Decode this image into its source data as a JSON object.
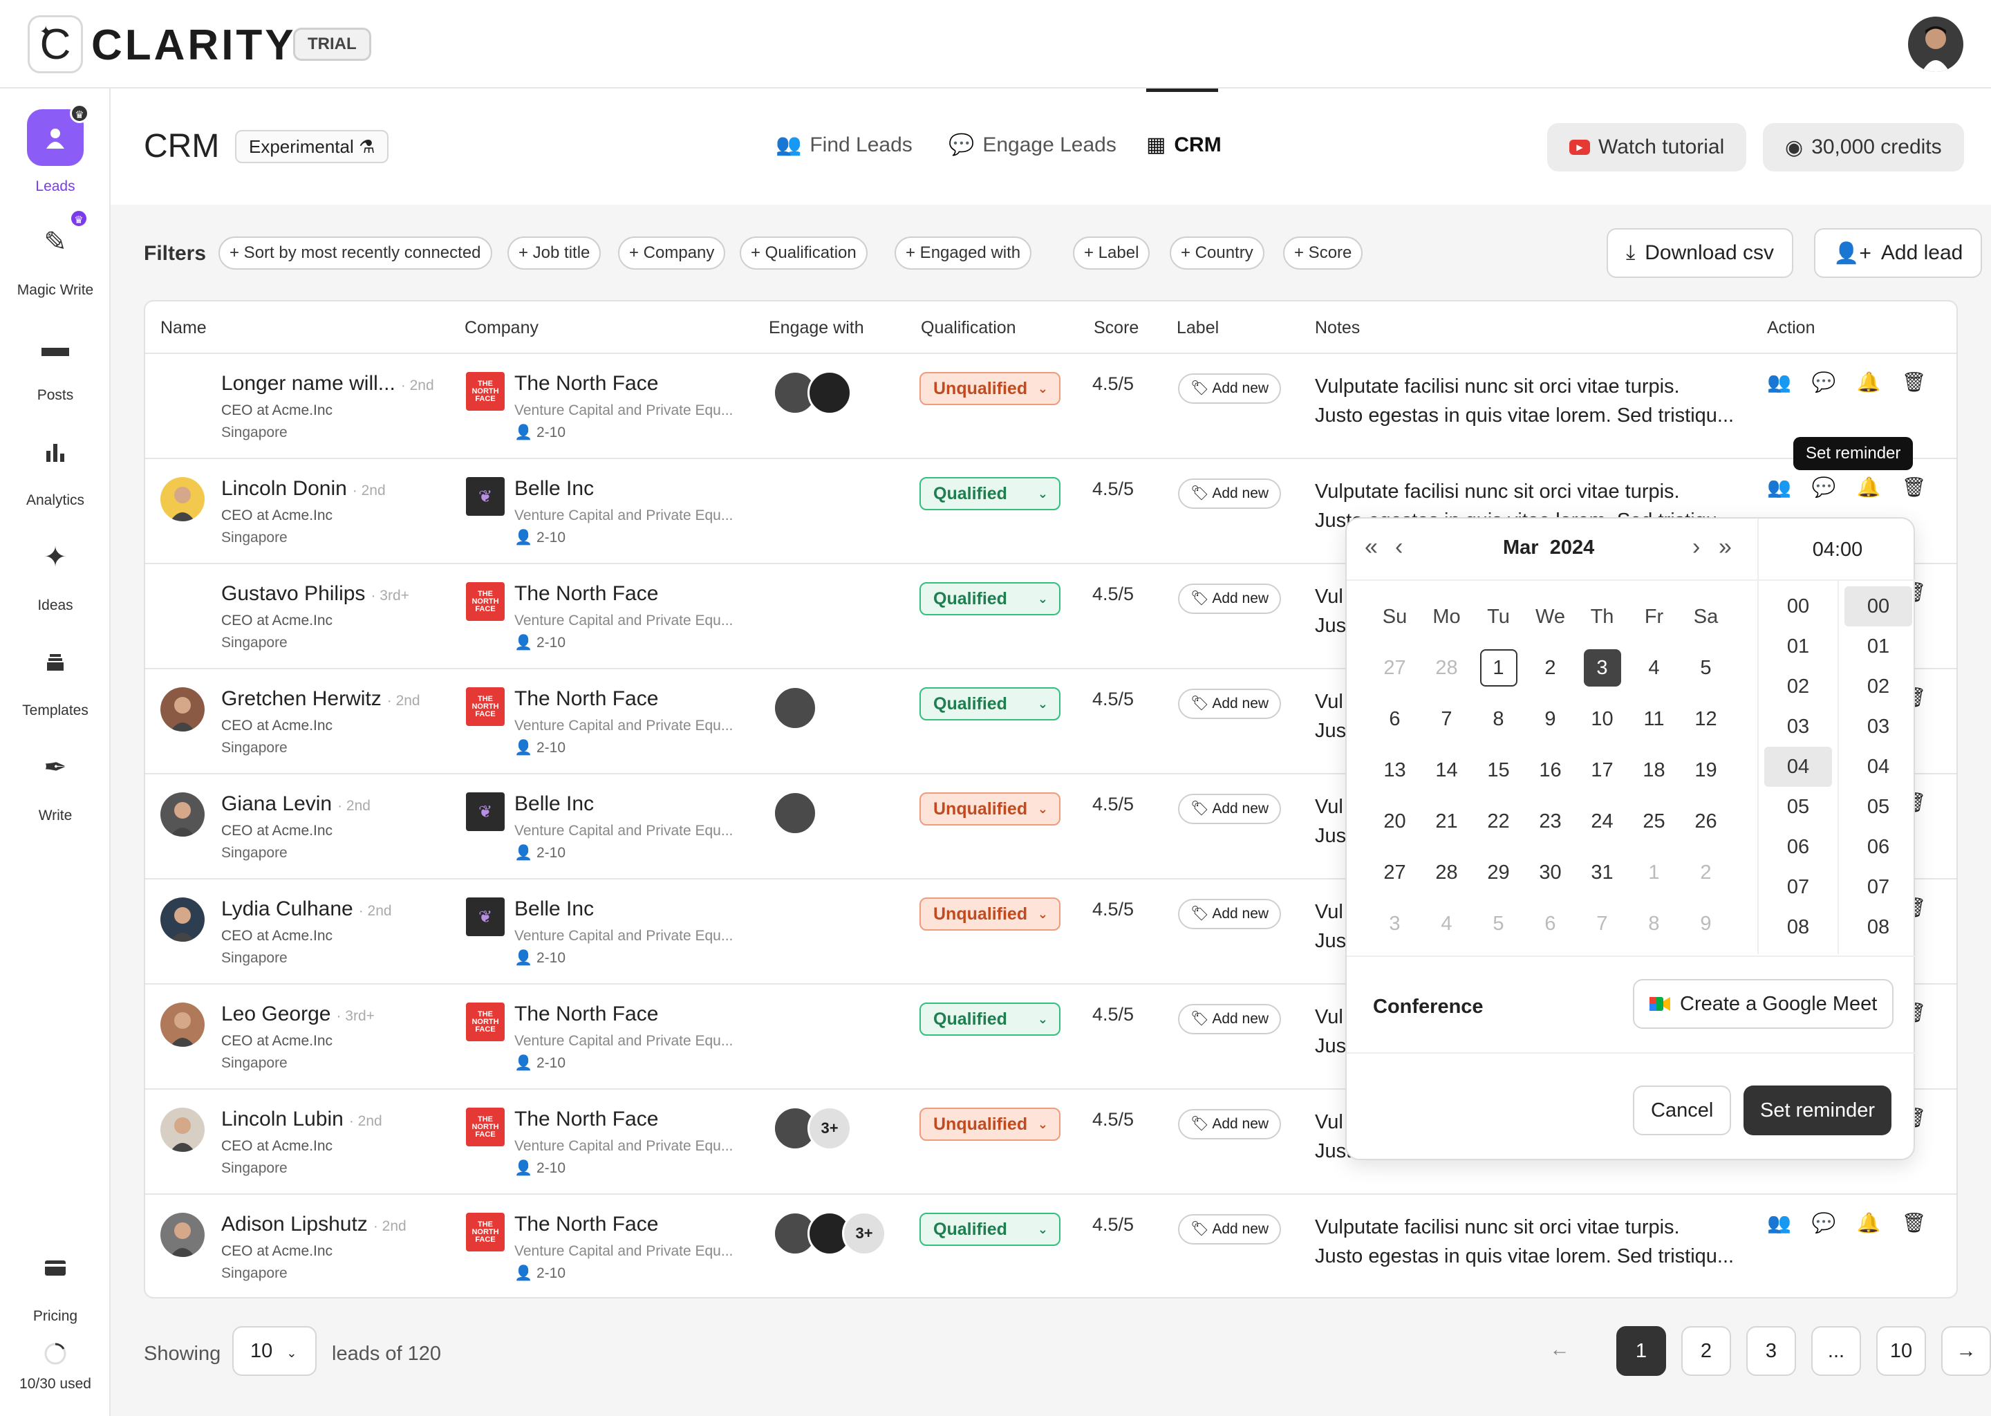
{
  "app": {
    "brand": "CLARITY",
    "trial": "TRIAL"
  },
  "sidebar": {
    "items": [
      {
        "label": "Leads",
        "icon": "leads-icon"
      },
      {
        "label": "Magic Write",
        "icon": "magic-write-icon"
      },
      {
        "label": "Posts",
        "icon": "posts-icon"
      },
      {
        "label": "Analytics",
        "icon": "analytics-icon"
      },
      {
        "label": "Ideas",
        "icon": "ideas-icon"
      },
      {
        "label": "Templates",
        "icon": "templates-icon"
      },
      {
        "label": "Write",
        "icon": "write-icon"
      }
    ],
    "pricing": "Pricing",
    "usage": "10/30 used"
  },
  "header": {
    "title": "CRM",
    "badge": "Experimental",
    "tabs": [
      {
        "label": "Find Leads"
      },
      {
        "label": "Engage Leads"
      },
      {
        "label": "CRM",
        "active": true
      }
    ],
    "watch_tutorial": "Watch tutorial",
    "credits": "30,000 credits"
  },
  "filters": {
    "label": "Filters",
    "chips": [
      "+ Sort by most recently connected",
      "+ Job title",
      "+ Company",
      "+ Qualification",
      "+ Engaged with",
      "+ Label",
      "+ Country",
      "+ Score"
    ],
    "download": "Download csv",
    "add_lead": "Add lead"
  },
  "table": {
    "columns": [
      "Name",
      "Company",
      "Engage with",
      "Qualification",
      "Score",
      "Label",
      "Notes",
      "Action"
    ],
    "rows": [
      {
        "name": "Longer name will...",
        "degree": "· 2nd",
        "title": "CEO at Acme.Inc",
        "location": "Singapore",
        "company": "The North Face",
        "industry": "Venture Capital and Private Equ...",
        "size": "2-10",
        "engage": 2,
        "more": "",
        "qualification": "Unqualified",
        "score": "4.5/5",
        "label": "Add new",
        "notes1": "Vulputate facilisi nunc sit orci vitae turpis.",
        "notes2": "Justo egestas in quis vitae lorem. Sed tristiqu..."
      },
      {
        "name": "Lincoln Donin",
        "degree": "· 2nd",
        "title": "CEO at Acme.Inc",
        "location": "Singapore",
        "company": "Belle Inc",
        "industry": "Venture Capital and Private Equ...",
        "size": "2-10",
        "engage": 0,
        "more": "",
        "qualification": "Qualified",
        "score": "4.5/5",
        "label": "Add new",
        "notes1": "Vulputate facilisi nunc sit orci vitae turpis.",
        "notes2": "Justo egestas in quis vitae lorem. Sed tristiqu..."
      },
      {
        "name": "Gustavo Philips",
        "degree": "· 3rd+",
        "title": "CEO at Acme.Inc",
        "location": "Singapore",
        "company": "The North Face",
        "industry": "Venture Capital and Private Equ...",
        "size": "2-10",
        "engage": 0,
        "more": "",
        "qualification": "Qualified",
        "score": "4.5/5",
        "label": "Add new",
        "notes1": "Vul",
        "notes2": "Just"
      },
      {
        "name": "Gretchen Herwitz",
        "degree": "· 2nd",
        "title": "CEO at Acme.Inc",
        "location": "Singapore",
        "company": "The North Face",
        "industry": "Venture Capital and Private Equ...",
        "size": "2-10",
        "engage": 1,
        "more": "",
        "qualification": "Qualified",
        "score": "4.5/5",
        "label": "Add new",
        "notes1": "Vul",
        "notes2": "Just"
      },
      {
        "name": "Giana Levin",
        "degree": "· 2nd",
        "title": "CEO at Acme.Inc",
        "location": "Singapore",
        "company": "Belle Inc",
        "industry": "Venture Capital and Private Equ...",
        "size": "2-10",
        "engage": 1,
        "more": "",
        "qualification": "Unqualified",
        "score": "4.5/5",
        "label": "Add new",
        "notes1": "Vul",
        "notes2": "Just"
      },
      {
        "name": "Lydia Culhane",
        "degree": "· 2nd",
        "title": "CEO at Acme.Inc",
        "location": "Singapore",
        "company": "Belle Inc",
        "industry": "Venture Capital and Private Equ...",
        "size": "2-10",
        "engage": 0,
        "more": "",
        "qualification": "Unqualified",
        "score": "4.5/5",
        "label": "Add new",
        "notes1": "Vul",
        "notes2": "Just"
      },
      {
        "name": "Leo George",
        "degree": "· 3rd+",
        "title": "CEO at Acme.Inc",
        "location": "Singapore",
        "company": "The North Face",
        "industry": "Venture Capital and Private Equ...",
        "size": "2-10",
        "engage": 0,
        "more": "",
        "qualification": "Qualified",
        "score": "4.5/5",
        "label": "Add new",
        "notes1": "Vul",
        "notes2": "Just"
      },
      {
        "name": "Lincoln Lubin",
        "degree": "· 2nd",
        "title": "CEO at Acme.Inc",
        "location": "Singapore",
        "company": "The North Face",
        "industry": "Venture Capital and Private Equ...",
        "size": "2-10",
        "engage": 1,
        "more": "3+",
        "qualification": "Unqualified",
        "score": "4.5/5",
        "label": "Add new",
        "notes1": "Vul",
        "notes2": "Just"
      },
      {
        "name": "Adison Lipshutz",
        "degree": "· 2nd",
        "title": "CEO at Acme.Inc",
        "location": "Singapore",
        "company": "The North Face",
        "industry": "Venture Capital and Private Equ...",
        "size": "2-10",
        "engage": 2,
        "more": "3+",
        "qualification": "Qualified",
        "score": "4.5/5",
        "label": "Add new",
        "notes1": "Vulputate facilisi nunc sit orci vitae turpis.",
        "notes2": "Justo egestas in quis vitae lorem. Sed tristiqu..."
      }
    ]
  },
  "tooltip": "Set reminder",
  "reminder": {
    "month": "Mar",
    "year": "2024",
    "time": "04:00",
    "weekdays": [
      "Su",
      "Mo",
      "Tu",
      "We",
      "Th",
      "Fr",
      "Sa"
    ],
    "weeks": [
      [
        "27",
        "28",
        "1",
        "2",
        "3",
        "4",
        "5"
      ],
      [
        "6",
        "7",
        "8",
        "9",
        "10",
        "11",
        "12"
      ],
      [
        "13",
        "14",
        "15",
        "16",
        "17",
        "18",
        "19"
      ],
      [
        "20",
        "21",
        "22",
        "23",
        "24",
        "25",
        "26"
      ],
      [
        "27",
        "28",
        "29",
        "30",
        "31",
        "1",
        "2"
      ],
      [
        "3",
        "4",
        "5",
        "6",
        "7",
        "8",
        "9"
      ]
    ],
    "hours": [
      "00",
      "01",
      "02",
      "03",
      "04",
      "05",
      "06",
      "07",
      "08"
    ],
    "minutes": [
      "00",
      "01",
      "02",
      "03",
      "04",
      "05",
      "06",
      "07",
      "08"
    ],
    "conference_label": "Conference",
    "google_meet": "Create a Google Meet",
    "cancel": "Cancel",
    "set_reminder": "Set reminder"
  },
  "footer": {
    "showing": "Showing",
    "page_size": "10",
    "leads_of": "leads of 120",
    "pages": [
      "1",
      "2",
      "3",
      "...",
      "10"
    ]
  }
}
